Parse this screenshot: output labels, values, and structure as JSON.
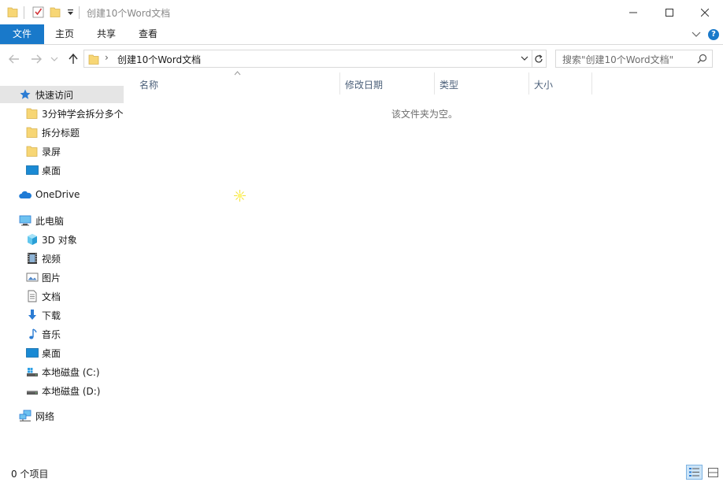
{
  "window": {
    "title": "创建10个Word文档",
    "accent": "#1979ca"
  },
  "ribbon": {
    "tabs": [
      "文件",
      "主页",
      "共享",
      "查看"
    ],
    "help_label": "?"
  },
  "address": {
    "path": "创建10个Word文档",
    "search_placeholder": "搜索\"创建10个Word文档\""
  },
  "sidebar": {
    "quick_access": "快速访问",
    "quick_items": [
      "3分钟学会拆分多个",
      "拆分标题",
      "录屏",
      "桌面"
    ],
    "onedrive": "OneDrive",
    "this_pc": "此电脑",
    "pc_items": [
      "3D 对象",
      "视频",
      "图片",
      "文档",
      "下载",
      "音乐",
      "桌面",
      "本地磁盘 (C:)",
      "本地磁盘 (D:)"
    ],
    "network": "网络"
  },
  "columns": [
    "名称",
    "修改日期",
    "类型",
    "大小"
  ],
  "content": {
    "empty_message": "该文件夹为空。"
  },
  "status": {
    "item_count": "0 个项目"
  },
  "icons": {
    "folder": "folder-icon",
    "star": "star-icon",
    "cloud": "onedrive-icon",
    "pc": "computer-icon",
    "network": "network-icon"
  }
}
